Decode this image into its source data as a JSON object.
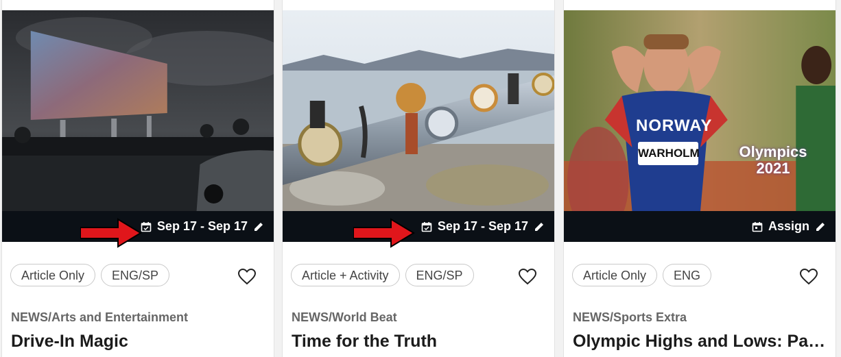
{
  "cards": [
    {
      "image_alt": "Drive-in movie screen at night",
      "date_label": "Sep 17 - Sep 17",
      "chips": [
        "Article Only",
        "ENG/SP"
      ],
      "category": "NEWS/Arts and Entertainment",
      "title": "Drive-In Magic",
      "icons": [
        "calendar-icon",
        "pencil-icon",
        "heart-icon"
      ]
    },
    {
      "image_alt": "Watches strapped to a pipe by the water",
      "date_label": "Sep 17 - Sep 17",
      "chips": [
        "Article + Activity",
        "ENG/SP"
      ],
      "category": "NEWS/World Beat",
      "title": "Time for the Truth",
      "icons": [
        "calendar-icon",
        "pencil-icon",
        "heart-icon"
      ]
    },
    {
      "image_alt": "Runner in Norway jersey reacting",
      "jersey_text": "NORWAY",
      "bib_text": "WARHOLM",
      "overlay_text": "Olympics 2021",
      "date_label": "Assign",
      "chips": [
        "Article Only",
        "ENG"
      ],
      "category": "NEWS/Sports Extra",
      "title": "Olympic Highs and Lows: Par...",
      "icons": [
        "calendar-icon",
        "pencil-icon",
        "heart-icon"
      ]
    }
  ],
  "annotations": {
    "arrow_color": "#e0161b",
    "arrow_count": 2
  },
  "colors": {
    "date_bar": "#0b1016",
    "chip_border": "#c9c9c9",
    "category_text": "#666666",
    "title_text": "#1b1b1b"
  }
}
